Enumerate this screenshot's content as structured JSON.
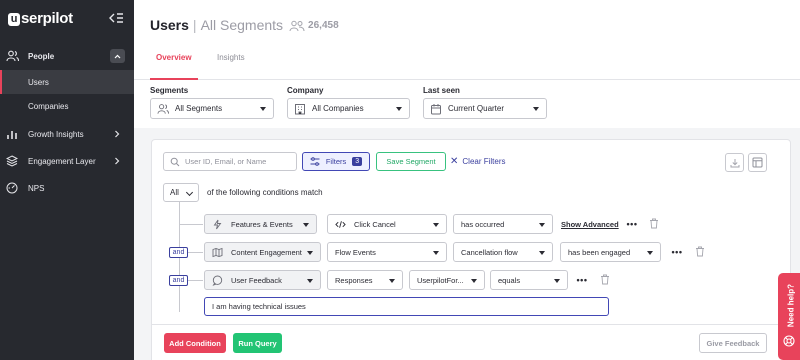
{
  "sidebar": {
    "logo": "userpilot",
    "items": [
      {
        "label": "People",
        "icon": "people-icon"
      },
      {
        "label": "Users"
      },
      {
        "label": "Companies"
      },
      {
        "label": "Growth Insights",
        "icon": "bar-chart-icon"
      },
      {
        "label": "Engagement Layer",
        "icon": "layers-icon"
      },
      {
        "label": "NPS",
        "icon": "gauge-icon"
      }
    ]
  },
  "header": {
    "title": "Users",
    "segment": "All Segments",
    "count": "26,458",
    "tabs": [
      {
        "label": "Overview",
        "active": true
      },
      {
        "label": "Insights",
        "active": false
      }
    ]
  },
  "filters_row": {
    "segments": {
      "label": "Segments",
      "value": "All Segments"
    },
    "company": {
      "label": "Company",
      "value": "All Companies"
    },
    "last_seen": {
      "label": "Last seen",
      "value": "Current Quarter"
    }
  },
  "toolbar": {
    "search_placeholder": "User ID, Email, or Name",
    "filters_label": "Filters",
    "filters_count": "3",
    "save_segment": "Save Segment",
    "clear_filters": "Clear Filters"
  },
  "conditions": {
    "match_select": "All",
    "match_text": "of the following conditions match",
    "connector": "and",
    "rows": [
      {
        "category": "Features & Events",
        "item": "Click Cancel",
        "operator": "has occurred",
        "extra_link": "Show Advanced"
      },
      {
        "category": "Content Engagement",
        "item": "Flow Events",
        "value": "Cancellation flow",
        "operator": "has been engaged"
      },
      {
        "category": "User Feedback",
        "item": "Responses",
        "value": "UserpilotFor...",
        "operator": "equals"
      }
    ],
    "text_value": "I am having technical issues"
  },
  "footer": {
    "add_condition": "Add Condition",
    "run_query": "Run Query",
    "give_feedback": "Give Feedback"
  },
  "help": {
    "label": "Need help?"
  },
  "colors": {
    "accent": "#e8435b",
    "primary": "#3a3f9e",
    "success": "#22c474",
    "sidebar": "#27292f"
  }
}
